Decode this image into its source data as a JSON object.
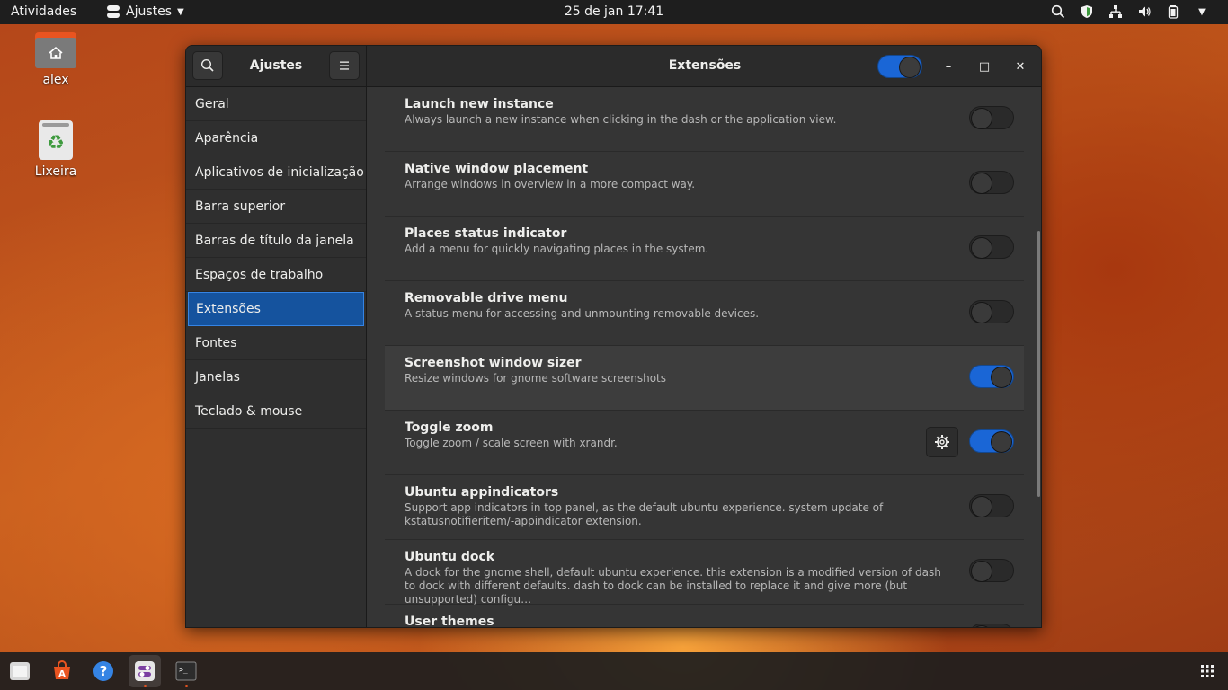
{
  "topbar": {
    "activities": "Atividades",
    "app_name": "Ajustes",
    "clock": "25 de jan  17:41"
  },
  "desktop": {
    "home_label": "alex",
    "trash_label": "Lixeira"
  },
  "window": {
    "sidebar_title": "Ajustes",
    "title": "Extensões",
    "extensions_enabled": true,
    "controls": {
      "minimize": "–",
      "maximize": "□",
      "close": "✕"
    }
  },
  "sidebar": {
    "items": [
      {
        "label": "Geral"
      },
      {
        "label": "Aparência"
      },
      {
        "label": "Aplicativos de inicialização"
      },
      {
        "label": "Barra superior"
      },
      {
        "label": "Barras de título da janela"
      },
      {
        "label": "Espaços de trabalho"
      },
      {
        "label": "Extensões",
        "active": true
      },
      {
        "label": "Fontes"
      },
      {
        "label": "Janelas"
      },
      {
        "label": "Teclado & mouse"
      }
    ]
  },
  "extensions": [
    {
      "title": "Launch new instance",
      "description": "Always launch a new instance when clicking in the dash or the application view.",
      "enabled": false
    },
    {
      "title": "Native window placement",
      "description": "Arrange windows in overview in a more compact way.",
      "enabled": false
    },
    {
      "title": "Places status indicator",
      "description": "Add a menu for quickly navigating places in the system.",
      "enabled": false
    },
    {
      "title": "Removable drive menu",
      "description": "A status menu for accessing and unmounting removable devices.",
      "enabled": false
    },
    {
      "title": "Screenshot window sizer",
      "description": "Resize windows for gnome software screenshots",
      "enabled": true
    },
    {
      "title": "Toggle zoom",
      "description": "Toggle zoom / scale screen with xrandr.",
      "enabled": true,
      "has_settings": true
    },
    {
      "title": "Ubuntu appindicators",
      "description": "Support app indicators in top panel, as the default ubuntu experience. system update of kstatusnotifieritem/-appindicator extension.",
      "enabled": false
    },
    {
      "title": "Ubuntu dock",
      "description": "A dock for the gnome shell, default ubuntu experience. this extension is a modified version of dash to dock with different defaults. dash to dock can be installed to replace it and give more (but unsupported) configu…",
      "enabled": false
    },
    {
      "title": "User themes",
      "description": "",
      "enabled": false
    }
  ],
  "colors": {
    "accent": "#1a66d6",
    "selection": "#15539e",
    "ubuntu_orange": "#e95420"
  },
  "dock_icons": [
    "files-icon",
    "software-center-icon",
    "help-icon",
    "tweaks-icon",
    "terminal-icon",
    "app-grid-icon"
  ]
}
